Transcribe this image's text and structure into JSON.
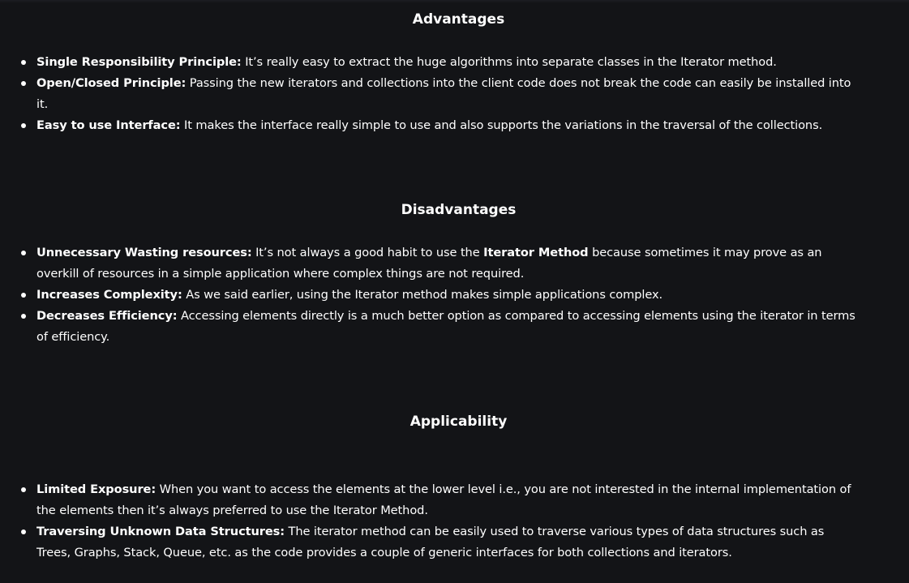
{
  "advantages": {
    "heading": "Advantages",
    "items": [
      {
        "term": "Single Responsibility Principle:",
        "text": " It’s really easy to extract the huge algorithms into separate classes in the Iterator method."
      },
      {
        "term": "Open/Closed Principle:",
        "text": " Passing the new iterators and collections into the client code does not break the code can easily be installed into it."
      },
      {
        "term": "Easy to use Interface:",
        "text": " It makes the interface really simple to use and also supports the variations in the traversal of the collections."
      }
    ]
  },
  "disadvantages": {
    "heading": "Disadvantages",
    "items": [
      {
        "term": "Unnecessary Wasting resources:",
        "text_before": " It’s not always a good habit to use the ",
        "emphasis": "Iterator Method",
        "text_after": " because sometimes it may prove as an overkill of resources in a simple application where complex things are not required."
      },
      {
        "term": "Increases Complexity:",
        "text": " As we said earlier, using the Iterator method makes simple applications complex."
      },
      {
        "term": "Decreases Efficiency:",
        "text": " Accessing elements directly is a much better option as compared to accessing elements using the iterator in terms of efficiency."
      }
    ]
  },
  "applicability": {
    "heading": "Applicability",
    "items": [
      {
        "term": "Limited Exposure:",
        "text": " When you want to access the elements at the lower level i.e., you are not interested in the internal implementation of the elements then it’s always preferred to use the Iterator Method."
      },
      {
        "term": "Traversing Unknown Data Structures:",
        "text": " The iterator method can be easily used to traverse various types of data structures such as Trees, Graphs, Stack, Queue, etc. as the code provides a couple of generic interfaces for both collections and iterators."
      }
    ]
  }
}
